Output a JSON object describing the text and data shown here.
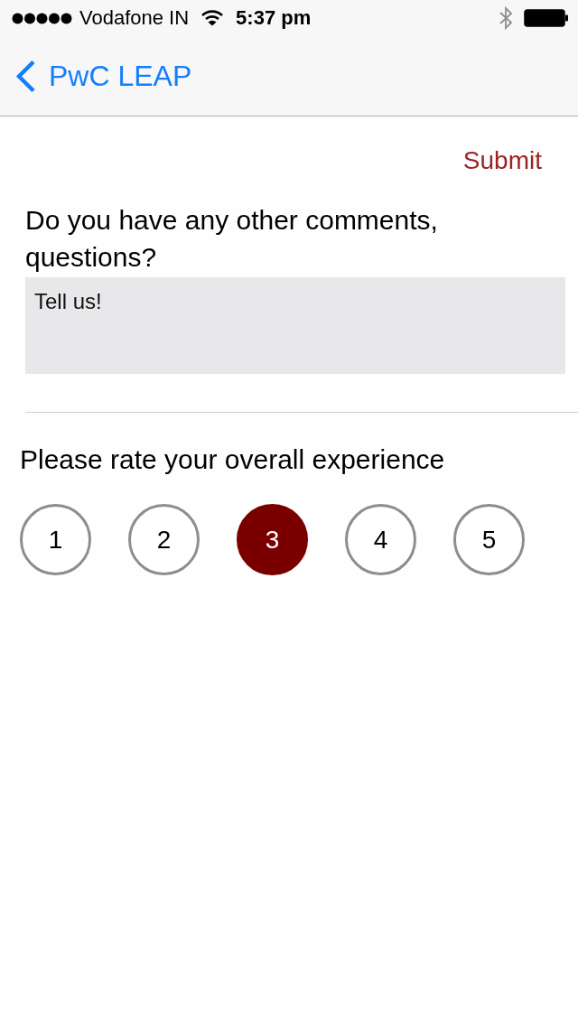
{
  "status_bar": {
    "carrier": "Vodafone IN",
    "time": "5:37 pm"
  },
  "nav_bar": {
    "back_label": "PwC LEAP"
  },
  "submit_label": "Submit",
  "comments": {
    "question": "Do you have any other comments, questions?",
    "placeholder": "Tell us!"
  },
  "rating": {
    "prompt": "Please rate your overall experience",
    "options": [
      {
        "label": "1",
        "selected": false
      },
      {
        "label": "2",
        "selected": false
      },
      {
        "label": "3",
        "selected": true
      },
      {
        "label": "4",
        "selected": false
      },
      {
        "label": "5",
        "selected": false
      }
    ]
  }
}
